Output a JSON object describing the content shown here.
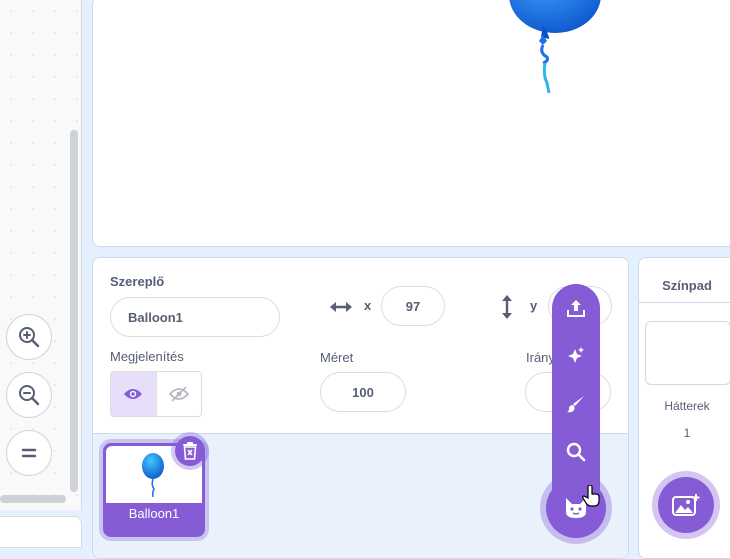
{
  "sprite_info": {
    "heading": "Szereplő",
    "name_value": "Balloon1",
    "x_label": "x",
    "x_value": "97",
    "y_label": "y",
    "show_label": "Megjelenítés",
    "size_label": "Méret",
    "size_value": "100",
    "direction_label": "Irány"
  },
  "sprites": [
    {
      "name": "Balloon1",
      "selected": true
    }
  ],
  "stage_panel": {
    "title": "Színpad",
    "backdrops_label": "Hátterek",
    "backdrops_count": "1"
  },
  "colors": {
    "accent": "#855cd6",
    "balloon": "#1e6fe8",
    "ribbon": "#2bb6f0"
  },
  "icons": {
    "zoom_in": "zoom-in-icon",
    "zoom_out": "zoom-out-icon",
    "zoom_reset": "zoom-reset-icon",
    "upload": "upload-icon",
    "surprise": "sparkle-icon",
    "paint": "paintbrush-icon",
    "search": "search-icon",
    "choose_sprite": "cat-icon",
    "choose_backdrop": "image-add-icon",
    "delete": "trash-icon"
  }
}
